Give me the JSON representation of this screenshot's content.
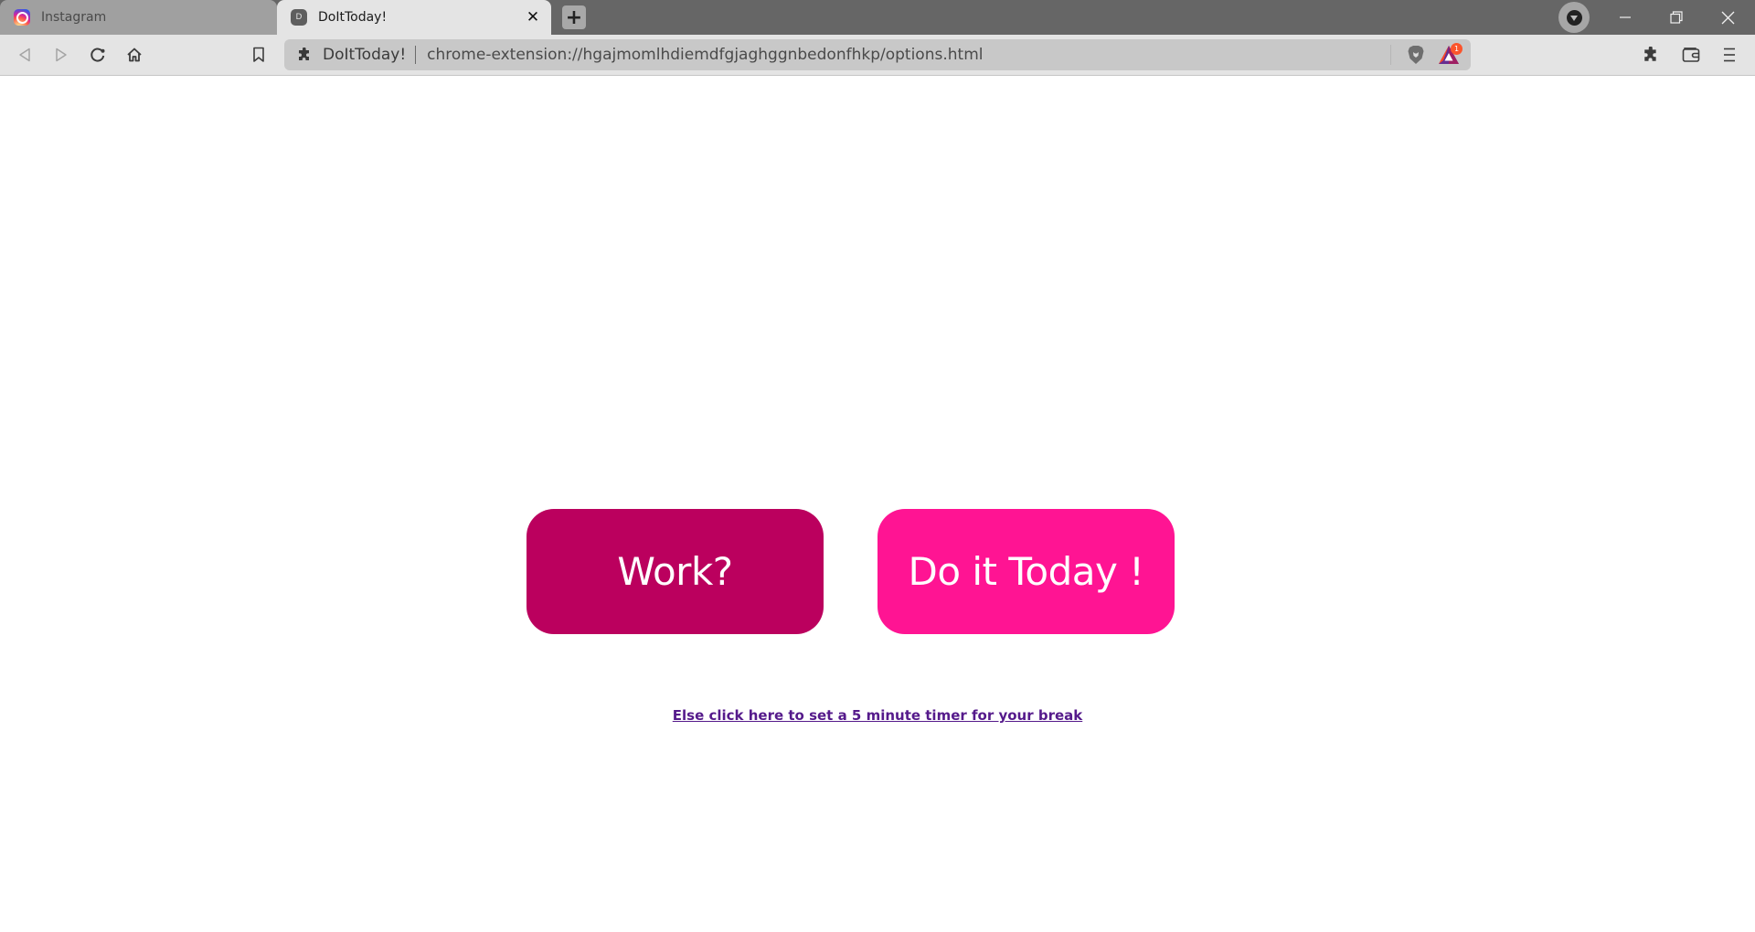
{
  "browser": {
    "tabs": [
      {
        "title": "Instagram",
        "favicon": "instagram-icon",
        "active": false
      },
      {
        "title": "DoItToday!",
        "favicon_letter": "D",
        "active": true
      }
    ],
    "close_tab_glyph": "✕",
    "new_tab_glyph": "+",
    "window_controls": {
      "minimize": "minimize-icon",
      "restore": "restore-icon",
      "close": "close-icon"
    },
    "toolbar": {
      "nav_icons": [
        "back-icon",
        "forward-icon",
        "reload-icon",
        "home-icon",
        "bookmark-icon"
      ],
      "omnibox": {
        "site_label": "DoItToday!",
        "url": "chrome-extension://hgajmomlhdiemdfgjaghggnbedonfhkp/options.html"
      },
      "rewards_badge_count": "1",
      "right_icons": [
        "extensions-icon",
        "wallet-icon",
        "menu-icon"
      ]
    }
  },
  "page": {
    "work_button": {
      "label": "Work?",
      "color": "#bb005e"
    },
    "today_button": {
      "label": "Do it Today !",
      "color": "#ff1493"
    },
    "break_link": {
      "label": "Else click here to set a 5 minute timer for your break",
      "color": "#551a8b"
    }
  }
}
